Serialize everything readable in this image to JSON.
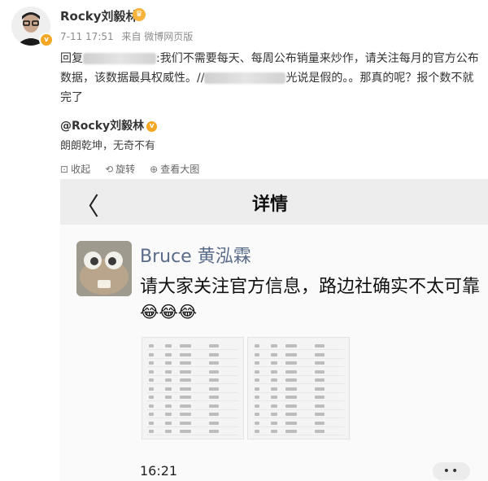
{
  "post": {
    "username": "Rocky刘毅林",
    "timestamp": "7-11 17:51",
    "source": "来自 微博网页版",
    "text_prefix": "回复",
    "text_part1": ":我们不需要每天、每周公布销量来炒作，请关注每月的官方公布数据，该数据最具权威性。//",
    "text_part2": "光说是假的。。那真的呢？报个数不就完了",
    "mention_name": "@Rocky刘毅林",
    "mention_text": "朗朗乾坤，无奇不有",
    "actions": [
      "收起",
      "旋转",
      "查看大图"
    ],
    "accent_color": "#f5a623"
  },
  "screenshot": {
    "title": "详情",
    "sender_name": "Bruce 黄泓霖",
    "message": "请大家关注官方信息，路边社确实不太可靠",
    "emoji": [
      "😂",
      "😂",
      "😂"
    ],
    "time": "16:21",
    "more": "••"
  }
}
